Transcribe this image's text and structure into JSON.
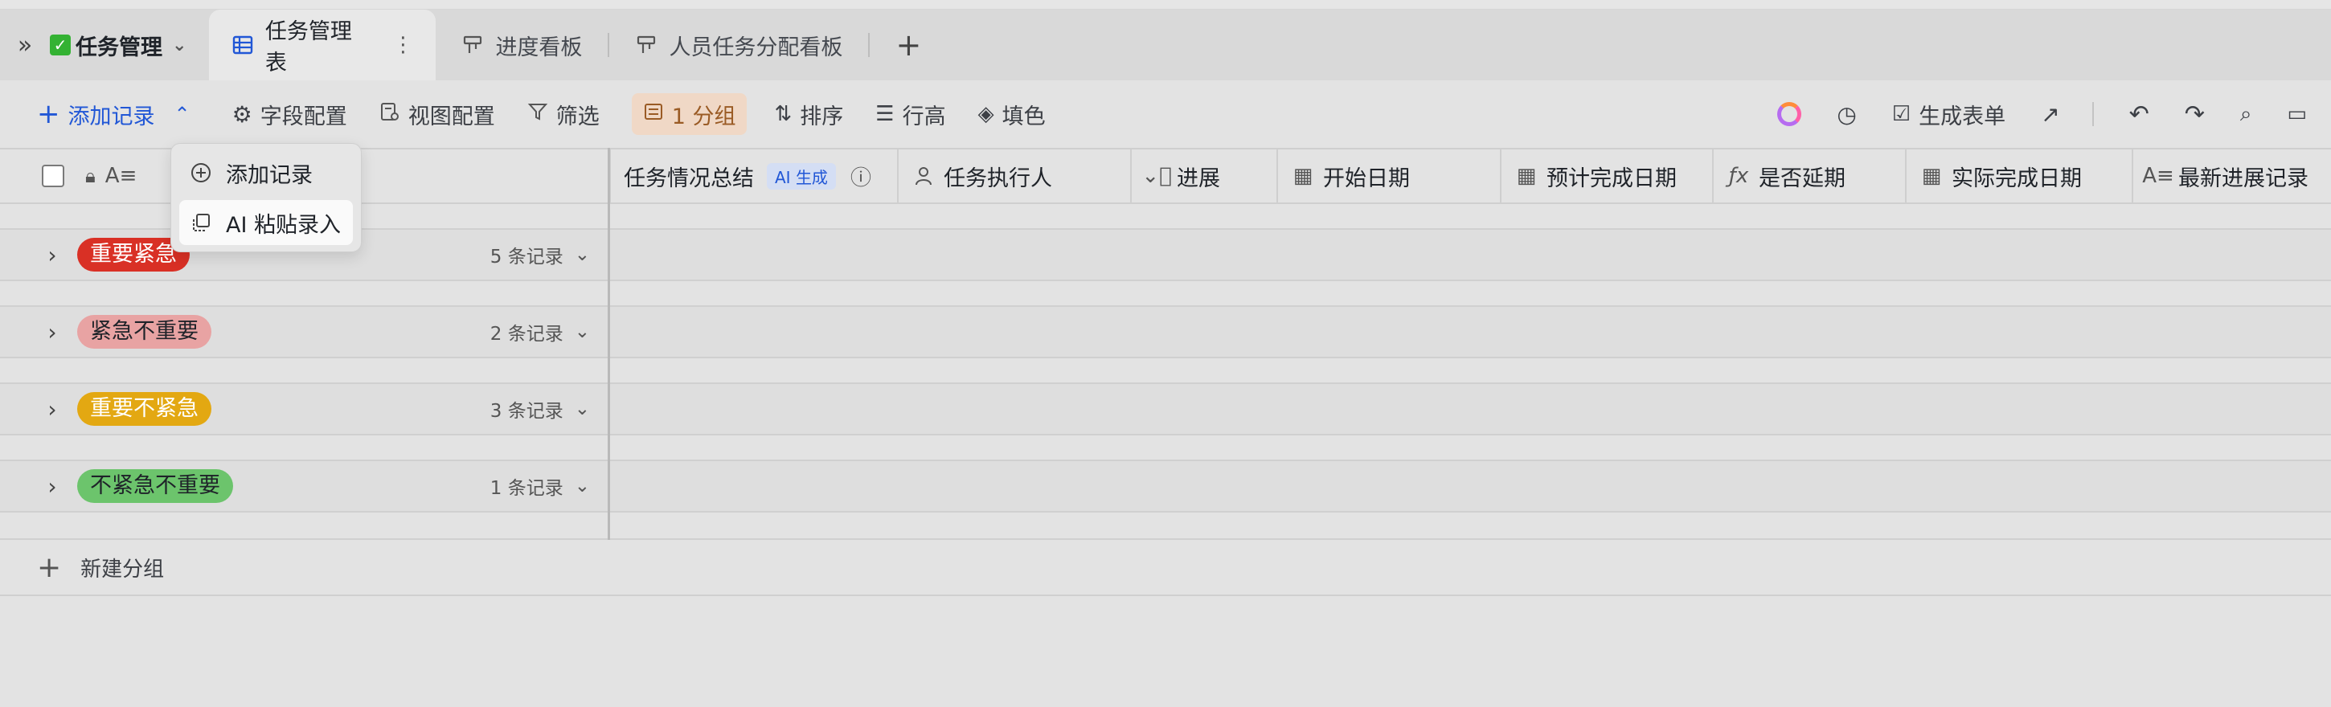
{
  "app": {
    "name": "任务管理"
  },
  "tabs": [
    {
      "label": "任务管理表",
      "icon": "table-icon",
      "active": true
    },
    {
      "label": "进度看板",
      "icon": "kanban-icon",
      "active": false
    },
    {
      "label": "人员任务分配看板",
      "icon": "kanban-icon",
      "active": false
    }
  ],
  "toolbar": {
    "add_record": "添加记录",
    "field_config": "字段配置",
    "view_config": "视图配置",
    "filter": "筛选",
    "group": "1 分组",
    "sort": "排序",
    "row_height": "行高",
    "fill_color": "填色",
    "generate_form": "生成表单"
  },
  "menu": {
    "items": [
      {
        "label": "添加记录",
        "icon": "plus-circle-icon"
      },
      {
        "label": "AI 粘贴录入",
        "icon": "ai-paste-icon"
      }
    ]
  },
  "columns": [
    {
      "label": "任务情况总结",
      "badge": "AI 生成",
      "icon": "info-icon"
    },
    {
      "label": "任务执行人",
      "icon": "person-icon"
    },
    {
      "label": "进展",
      "icon": "select-icon"
    },
    {
      "label": "开始日期",
      "icon": "calendar-icon"
    },
    {
      "label": "预计完成日期",
      "icon": "calendar-icon"
    },
    {
      "label": "是否延期",
      "icon": "formula-icon"
    },
    {
      "label": "实际完成日期",
      "icon": "calendar-icon"
    },
    {
      "label": "最新进展记录",
      "icon": "text-icon"
    }
  ],
  "groups": [
    {
      "label": "重要紧急",
      "count": "5 条记录",
      "bg": "#d93025",
      "fg": "#ffffff"
    },
    {
      "label": "紧急不重要",
      "count": "2 条记录",
      "bg": "#e8a3a3",
      "fg": "#1f2329"
    },
    {
      "label": "重要不紧急",
      "count": "3 条记录",
      "bg": "#e3a812",
      "fg": "#ffffff"
    },
    {
      "label": "不紧急不重要",
      "count": "1 条记录",
      "bg": "#6cc46c",
      "fg": "#1f2329"
    }
  ],
  "new_group": "新建分组"
}
